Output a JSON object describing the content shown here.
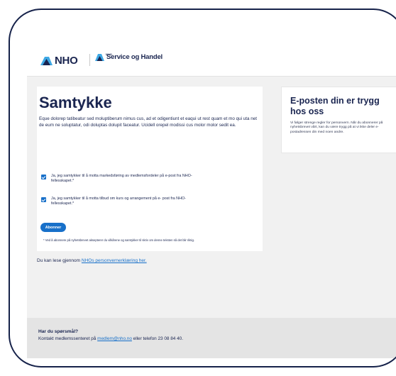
{
  "header": {
    "nho_logo_text": "NHO",
    "sh_small_text": "NHO",
    "sh_logo_text": "Service og Handel"
  },
  "main": {
    "title": "Samtykke",
    "intro": "Eque dolorep tatibeatur sed moluptiberum nimus cus, ad et odigentiunt et eaqui ut rest quam et mo qui uta net de eum ne soluptatur, odi doluptas dolupit faceatur. Ucidell orepel modissi cus molor molor sedit ea.",
    "checkbox_1_label": "Ja, jeg samtykker til å motta markedsføring av medlemsfordeler på e-post fra NHO- fellesskapet.*",
    "checkbox_2_label": "Ja, jeg samtykker til å motta tilbud om kurs og arrangement på e- post fra NHO-fellesskapet.*",
    "subscribe_label": "Abonner",
    "disclaimer": "* Ved å abonnere på nyhetsbrevet aksepterer du vilkårene og samtykker til skriv om denne teksten så det blir riktig."
  },
  "privacy": {
    "prefix": "Du kan lese gjennom ",
    "link": "NHOs personvernerklæring her."
  },
  "side": {
    "title": "E-posten din er trygg hos oss",
    "text": "Vi følger strenge regler for personvern. Når du abonnerer på nyhetsbrevet vårt, kan du være trygg på at vi ikke deler e-postadressen din med noen andre."
  },
  "footer": {
    "title": "Har du spørsmål?",
    "prefix": "Kontakt medlemssenteret på ",
    "email": "medlem@nho.no",
    "suffix": " eller telefon 23 08 84 40."
  },
  "colors": {
    "navy": "#1a2550",
    "accent_blue": "#1870c9",
    "logo_light_blue": "#3fa9e5"
  }
}
